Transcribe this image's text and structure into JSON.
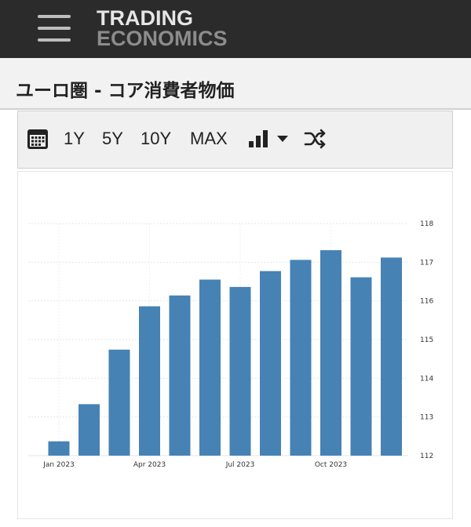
{
  "header": {
    "logo_line1": "TRADING",
    "logo_line2": "ECONOMICS"
  },
  "page": {
    "title": "ユーロ圏 - コア消費者物価"
  },
  "toolbar": {
    "range_buttons": [
      "1Y",
      "5Y",
      "10Y",
      "MAX"
    ],
    "icons": [
      "calendar-icon",
      "bar-chart-icon",
      "caret-down-icon",
      "shuffle-icon"
    ]
  },
  "colors": {
    "bar": "#4682b4",
    "header_bg": "#2b2b2b",
    "titlebar_bg": "#f2f2f2",
    "toolbar_bg": "#f0f0f0"
  },
  "chart_data": {
    "type": "bar",
    "categories": [
      "Jan 2023",
      "Feb 2023",
      "Mar 2023",
      "Apr 2023",
      "May 2023",
      "Jun 2023",
      "Jul 2023",
      "Aug 2023",
      "Sep 2023",
      "Oct 2023",
      "Nov 2023",
      "Dec 2023"
    ],
    "values": [
      112.37,
      113.33,
      114.74,
      115.86,
      116.14,
      116.55,
      116.36,
      116.77,
      117.06,
      117.31,
      116.61,
      117.12
    ],
    "x_tick_labels": [
      {
        "category": "Jan 2023",
        "label": "Jan 2023"
      },
      {
        "category": "Apr 2023",
        "label": "Apr 2023"
      },
      {
        "category": "Jul 2023",
        "label": "Jul 2023"
      },
      {
        "category": "Oct 2023",
        "label": "Oct 2023"
      }
    ],
    "y_ticks": [
      112,
      113,
      114,
      115,
      116,
      117,
      118
    ],
    "ylim": [
      112,
      118
    ],
    "y_axis_side": "right",
    "grid": true,
    "title": "",
    "xlabel": "",
    "ylabel": ""
  }
}
